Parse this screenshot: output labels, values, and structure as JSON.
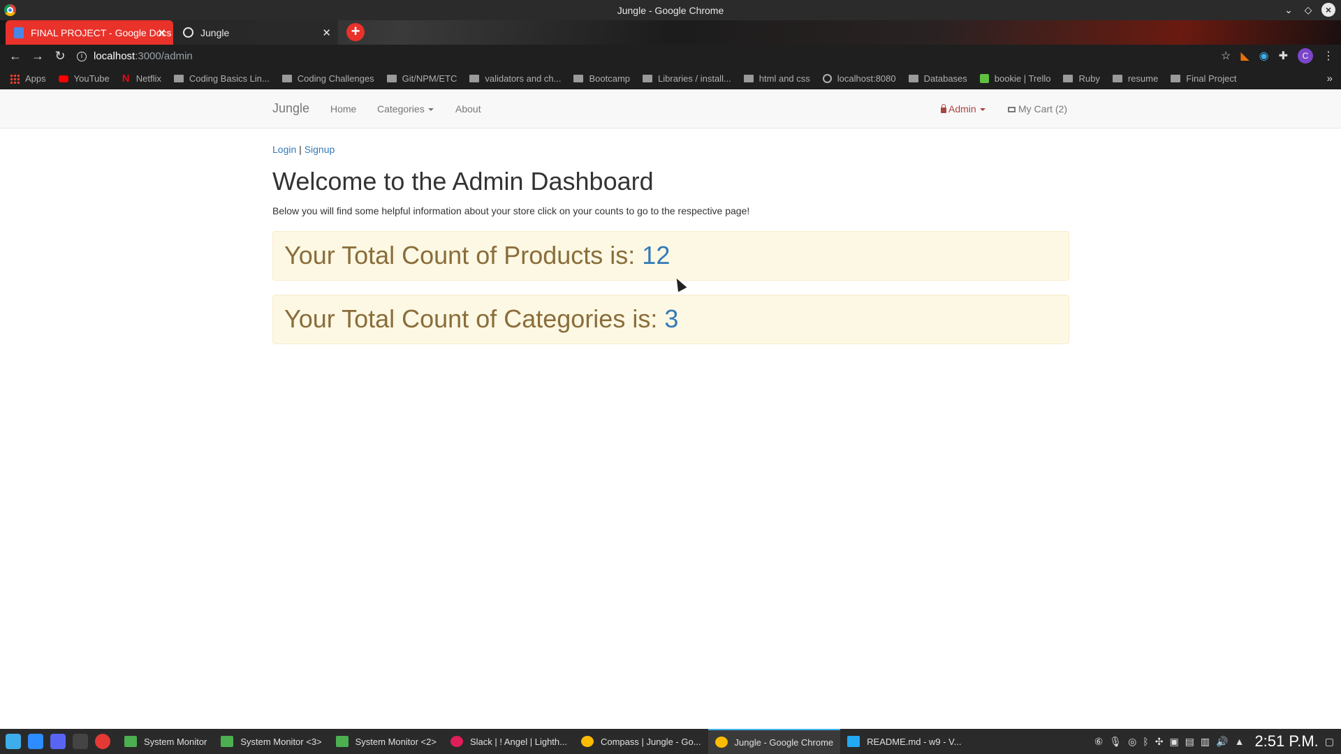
{
  "window": {
    "title": "Jungle - Google Chrome"
  },
  "tabs": [
    {
      "label": "FINAL PROJECT - Google Docs"
    },
    {
      "label": "Jungle"
    }
  ],
  "address": {
    "host": "localhost",
    "path": ":3000/admin"
  },
  "bookmarks": [
    {
      "label": "Apps",
      "icon": "apps-grid-icon"
    },
    {
      "label": "YouTube",
      "icon": "youtube-icon"
    },
    {
      "label": "Netflix",
      "icon": "netflix-icon"
    },
    {
      "label": "Coding Basics Lin...",
      "icon": "folder-icon"
    },
    {
      "label": "Coding Challenges",
      "icon": "folder-icon"
    },
    {
      "label": "Git/NPM/ETC",
      "icon": "folder-icon"
    },
    {
      "label": "validators and ch...",
      "icon": "folder-icon"
    },
    {
      "label": "Bootcamp",
      "icon": "folder-icon"
    },
    {
      "label": "Libraries / install...",
      "icon": "folder-icon"
    },
    {
      "label": "html and css",
      "icon": "folder-icon"
    },
    {
      "label": "localhost:8080",
      "icon": "globe-icon"
    },
    {
      "label": "Databases",
      "icon": "folder-icon"
    },
    {
      "label": "bookie | Trello",
      "icon": "trello-icon"
    },
    {
      "label": "Ruby",
      "icon": "folder-icon"
    },
    {
      "label": "resume",
      "icon": "folder-icon"
    },
    {
      "label": "Final Project",
      "icon": "folder-icon"
    }
  ],
  "navbar": {
    "brand": "Jungle",
    "home": "Home",
    "categories": "Categories",
    "about": "About",
    "admin": "Admin",
    "cart": "My Cart (2)"
  },
  "auth": {
    "login": "Login",
    "separator": "|",
    "signup": "Signup"
  },
  "page": {
    "title": "Welcome to the Admin Dashboard",
    "intro": "Below you will find some helpful information about your store click on your counts to go to the respective page!",
    "products_label": "Your Total Count of Products is:",
    "products_count": "12",
    "categories_label": "Your Total Count of Categories is:",
    "categories_count": "3"
  },
  "taskbar": {
    "apps": [
      {
        "label": "System Monitor",
        "active": false
      },
      {
        "label": "System Monitor <3>",
        "active": false
      },
      {
        "label": "System Monitor <2>",
        "active": false
      },
      {
        "label": "Slack | ! Angel | Lighth...",
        "active": false
      },
      {
        "label": "Compass | Jungle - Go...",
        "active": false
      },
      {
        "label": "Jungle - Google Chrome",
        "active": true
      },
      {
        "label": "README.md - w9 - V...",
        "active": false
      }
    ],
    "clock": "2:51 P.M."
  },
  "colors": {
    "warning_bg": "#fcf8e3",
    "warning_text": "#8a6d3b",
    "link": "#337ab7",
    "admin": "#a94442"
  }
}
